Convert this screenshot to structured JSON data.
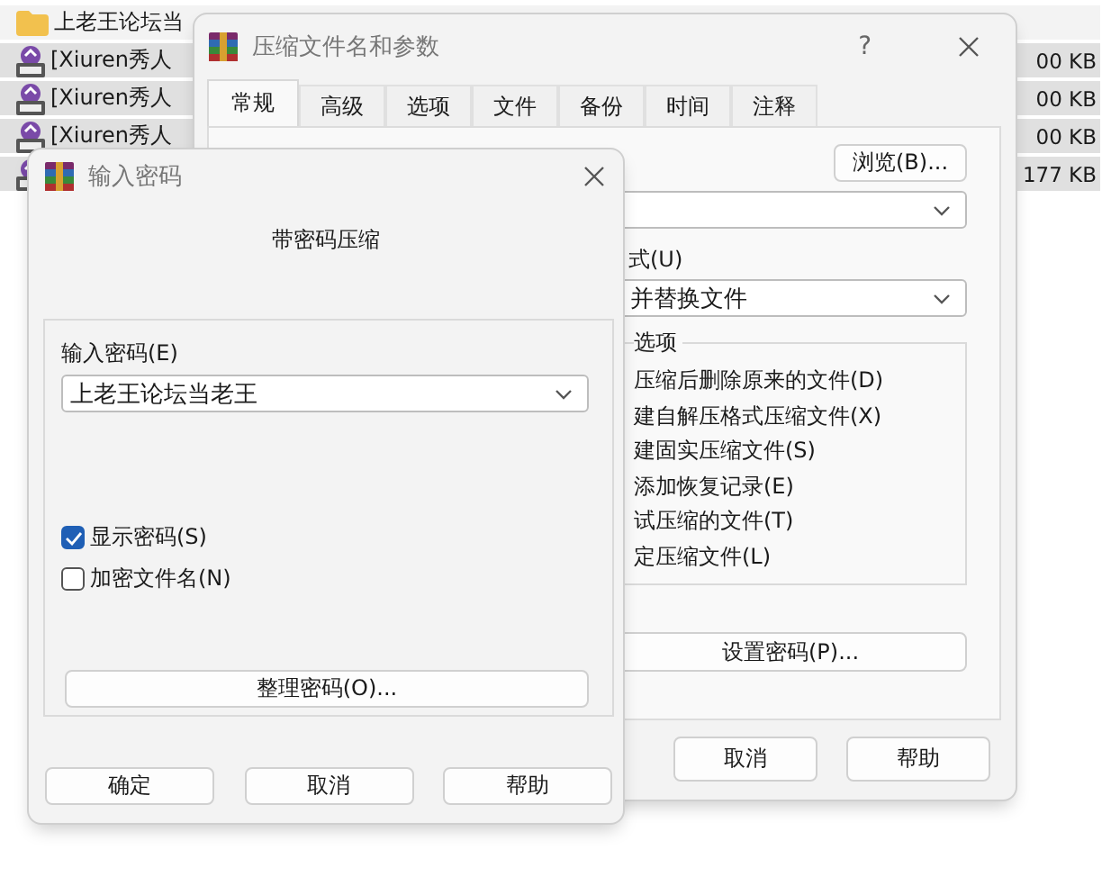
{
  "file_list": {
    "rows": [
      {
        "kind": "folder",
        "name": "上老王论坛当",
        "selected": false
      },
      {
        "kind": "archive",
        "name": "[Xiuren秀人",
        "size": "00 KB",
        "selected": true
      },
      {
        "kind": "archive",
        "name": "[Xiuren秀人",
        "size": "00 KB",
        "selected": true
      },
      {
        "kind": "archive",
        "name": "[Xiuren秀人",
        "size": "00 KB",
        "selected": true
      },
      {
        "kind": "archive",
        "size": "177 KB",
        "selected": true
      }
    ]
  },
  "archive_dialog": {
    "title": "压缩文件名和参数",
    "help": "?",
    "tabs": [
      {
        "label": "常规",
        "selected": true
      },
      {
        "label": "高级",
        "selected": false
      },
      {
        "label": "选项",
        "selected": false
      },
      {
        "label": "文件",
        "selected": false
      },
      {
        "label": "备份",
        "selected": false
      },
      {
        "label": "时间",
        "selected": false
      },
      {
        "label": "注释",
        "selected": false
      }
    ],
    "browse_button": "浏览(B)...",
    "update_mode": {
      "label": "式(U)",
      "value": "并替换文件"
    },
    "options_group": {
      "title": "选项",
      "items": [
        "压缩后删除原来的文件(D)",
        "建自解压格式压缩文件(X)",
        "建固实压缩文件(S)",
        "添加恢复记录(E)",
        "试压缩的文件(T)",
        "定压缩文件(L)"
      ]
    },
    "set_password_button": "设置密码(P)...",
    "buttons": [
      "取消",
      "帮助"
    ]
  },
  "password_dialog": {
    "title": "输入密码",
    "heading": "带密码压缩",
    "password": {
      "label": "输入密码(E)",
      "value": "上老王论坛当老王"
    },
    "options": [
      {
        "label": "显示密码(S)",
        "checked": true
      },
      {
        "label": "加密文件名(N)",
        "checked": false
      }
    ],
    "organize_button": "整理密码(O)...",
    "buttons": [
      "确定",
      "取消",
      "帮助"
    ]
  }
}
